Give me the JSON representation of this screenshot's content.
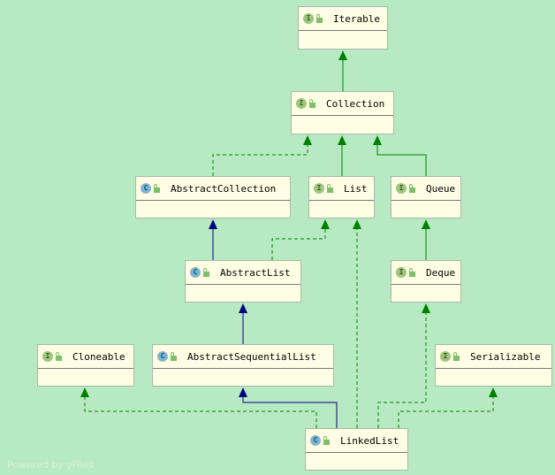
{
  "diagram": {
    "colors": {
      "background": "#b7eac2",
      "interface_edge": "#008000",
      "class_edge": "#000080",
      "node_fill": "#fefee4"
    },
    "nodes": [
      {
        "id": "iterable",
        "name": "Iterable",
        "kind": "I"
      },
      {
        "id": "collection",
        "name": "Collection",
        "kind": "I"
      },
      {
        "id": "abstractcollection",
        "name": "AbstractCollection",
        "kind": "C"
      },
      {
        "id": "list",
        "name": "List",
        "kind": "I"
      },
      {
        "id": "queue",
        "name": "Queue",
        "kind": "I"
      },
      {
        "id": "abstractlist",
        "name": "AbstractList",
        "kind": "C"
      },
      {
        "id": "deque",
        "name": "Deque",
        "kind": "I"
      },
      {
        "id": "cloneable",
        "name": "Cloneable",
        "kind": "I"
      },
      {
        "id": "abstractsequentiallist",
        "name": "AbstractSequentialList",
        "kind": "C"
      },
      {
        "id": "serializable",
        "name": "Serializable",
        "kind": "I"
      },
      {
        "id": "linkedlist",
        "name": "LinkedList",
        "kind": "C"
      }
    ],
    "edges": [
      {
        "from": "collection",
        "to": "iterable",
        "type": "extends-interface"
      },
      {
        "from": "abstractcollection",
        "to": "collection",
        "type": "implements"
      },
      {
        "from": "list",
        "to": "collection",
        "type": "extends-interface"
      },
      {
        "from": "queue",
        "to": "collection",
        "type": "extends-interface"
      },
      {
        "from": "abstractlist",
        "to": "abstractcollection",
        "type": "extends-class"
      },
      {
        "from": "abstractlist",
        "to": "list",
        "type": "implements"
      },
      {
        "from": "deque",
        "to": "queue",
        "type": "extends-interface"
      },
      {
        "from": "abstractsequentiallist",
        "to": "abstractlist",
        "type": "extends-class"
      },
      {
        "from": "linkedlist",
        "to": "abstractsequentiallist",
        "type": "extends-class"
      },
      {
        "from": "linkedlist",
        "to": "list",
        "type": "implements"
      },
      {
        "from": "linkedlist",
        "to": "cloneable",
        "type": "implements"
      },
      {
        "from": "linkedlist",
        "to": "deque",
        "type": "implements"
      },
      {
        "from": "linkedlist",
        "to": "serializable",
        "type": "implements"
      }
    ],
    "watermark": "Powered by yFiles"
  }
}
